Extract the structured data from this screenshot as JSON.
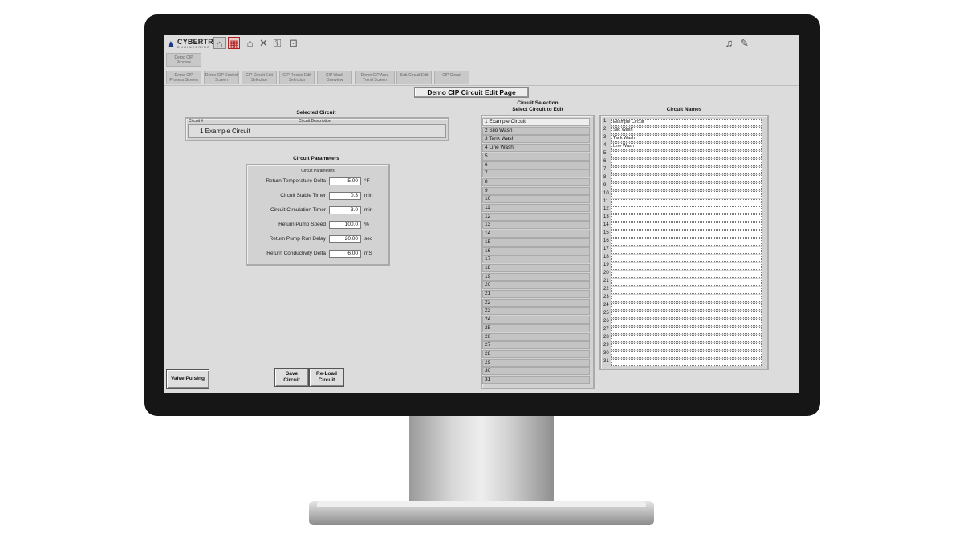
{
  "toolbar": {
    "logo_name": "CYBERTROL",
    "logo_sub": "ENGINEERING",
    "icons": [
      "plant-icon",
      "alarm-factory-icon",
      "home-icon",
      "close-icon",
      "key-icon",
      "lock-icon",
      "bell-icon",
      "mute-icon"
    ]
  },
  "nav": {
    "top": "Demo CIP Process",
    "tabs": [
      "Demo CIP Process Screen",
      "Demo CIP Control Screen",
      "CIP Circuit Edit Selection",
      "CIP Recipe Edit Selection",
      "CIP Wash Overview",
      "Demo CIP Area Trend Screen",
      "Sub-Circuit Edit",
      "CIP Circuit"
    ]
  },
  "page_title": "Demo CIP Circuit Edit Page",
  "selected": {
    "heading": "Selected Circuit",
    "col_num": "Circuit #",
    "col_desc": "Circuit Description",
    "value": "1   Example Circuit"
  },
  "params": {
    "heading": "Circuit Parameters",
    "box_label": "Circuit Parameters",
    "rows": [
      {
        "label": "Return Temperature Delta",
        "value": "5.00",
        "unit": "°F"
      },
      {
        "label": "Circuit Stable Timer",
        "value": "0.3",
        "unit": "min"
      },
      {
        "label": "Circuit Circulation Timer",
        "value": "3.0",
        "unit": "min"
      },
      {
        "label": "Return Pump Speed",
        "value": "100.0",
        "unit": "%"
      },
      {
        "label": "Return Pump Run Delay",
        "value": "20.00",
        "unit": "sec"
      },
      {
        "label": "Return Conductivity Delta",
        "value": "6.00",
        "unit": "mS"
      }
    ]
  },
  "buttons": {
    "valve_pulsing": "Valve Pulsing",
    "save_1": "Save",
    "save_2": "Circuit",
    "reload_1": "Re-Load",
    "reload_2": "Circuit"
  },
  "selection": {
    "heading_1": "Circuit Selection",
    "heading_2": "Select Circuit to Edit",
    "items": [
      "1 Example Circuit",
      "2 Silo Wash",
      "3 Tank Wash",
      "4 Line Wash",
      "5",
      "6",
      "7",
      "8",
      "9",
      "10",
      "11",
      "12",
      "13",
      "14",
      "15",
      "16",
      "17",
      "18",
      "19",
      "20",
      "21",
      "22",
      "23",
      "24",
      "25",
      "26",
      "27",
      "28",
      "29",
      "30",
      "31"
    ]
  },
  "names": {
    "heading": "Circuit Names",
    "numbers": [
      "1",
      "2",
      "3",
      "4",
      "5",
      "6",
      "7",
      "8",
      "9",
      "10",
      "11",
      "12",
      "13",
      "14",
      "15",
      "16",
      "17",
      "18",
      "19",
      "20",
      "21",
      "22",
      "23",
      "24",
      "25",
      "26",
      "27",
      "28",
      "29",
      "30",
      "31"
    ],
    "values": [
      "Example Circuit",
      "Silo Wash",
      "Tank Wash",
      "Line Wash",
      "",
      "",
      "",
      "",
      "",
      "",
      "",
      "",
      "",
      "",
      "",
      "",
      "",
      "",
      "",
      "",
      "",
      "",
      "",
      "",
      "",
      "",
      "",
      "",
      "",
      "",
      ""
    ]
  }
}
